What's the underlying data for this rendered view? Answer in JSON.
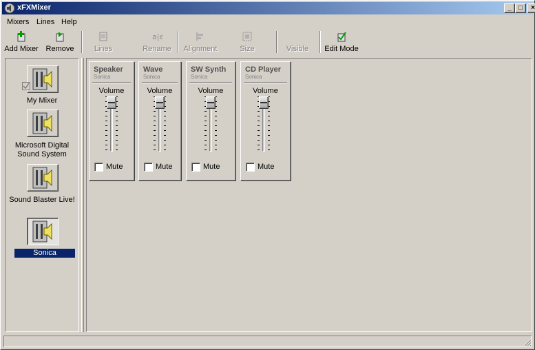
{
  "window": {
    "title": "xFXMixer",
    "controls": {
      "minimize": "_",
      "maximize": "□",
      "close": "×"
    }
  },
  "menubar": {
    "items": [
      "Mixers",
      "Lines",
      "Help"
    ]
  },
  "toolbar": {
    "add_mixer": "Add Mixer",
    "remove": "Remove",
    "lines": "Lines",
    "rename": "Rename",
    "alignment": "Alignment",
    "size": "Size",
    "visible": "Visible",
    "edit_mode": "Edit Mode"
  },
  "sidebar": {
    "mixers": [
      {
        "label": "My Mixer",
        "checked": true,
        "selected": false
      },
      {
        "label": "Microsoft Digital Sound System",
        "checked": false,
        "selected": false
      },
      {
        "label": "Sound Blaster Live!",
        "checked": false,
        "selected": false
      },
      {
        "label": "Sonica",
        "checked": false,
        "selected": true
      }
    ]
  },
  "lines": [
    {
      "name": "Speaker",
      "device": "Sonica",
      "control_label": "Volume",
      "volume_level": 1.0,
      "mute_label": "Mute",
      "muted": false
    },
    {
      "name": "Wave",
      "device": "Sonica",
      "control_label": "Volume",
      "volume_level": 1.0,
      "mute_label": "Mute",
      "muted": false
    },
    {
      "name": "SW Synth",
      "device": "Sonica",
      "control_label": "Volume",
      "volume_level": 1.0,
      "mute_label": "Mute",
      "muted": false
    },
    {
      "name": "CD Player",
      "device": "Sonica",
      "control_label": "Volume",
      "volume_level": 1.0,
      "mute_label": "Mute",
      "muted": false
    }
  ],
  "colors": {
    "face": "#d4d0c8",
    "title_start": "#0a246a",
    "title_end": "#a6caf0",
    "selection": "#0a246a"
  }
}
